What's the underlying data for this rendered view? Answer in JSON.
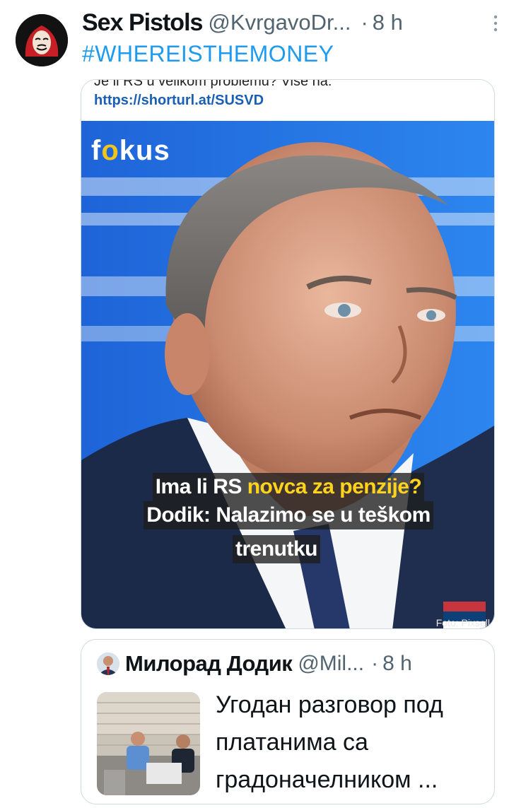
{
  "tweet": {
    "display_name": "Sex Pistols",
    "handle": "@KvrgavoDr...",
    "dot": "·",
    "time": "8 h",
    "hashtag": "#WHEREISTHEMONEY",
    "avatar_icon": "money-heist-mask-icon",
    "more_icon": "more-vertical-icon"
  },
  "media": {
    "cut_text": "Je li RS u velikom problemu? Više na:",
    "link": "https://shorturl.at/SUSVD",
    "logo_prefix": "f",
    "logo_o": "o",
    "logo_suffix": "kus",
    "headline_line1_a": "Ima li RS ",
    "headline_line1_b": "novca za penzije?",
    "headline_line2": "Dodik: Nalazimo se u teškom",
    "headline_line3": "trenutku",
    "photo_credit": "Foto: Pixsell",
    "accent_blue": "#1f6fe0",
    "accent_yellow": "#ffd21c"
  },
  "quote": {
    "display_name": "Милорад Додик",
    "handle": "@Mil...",
    "dot": "·",
    "time": "8 h",
    "text": "Угодан разговор под платанима са градоначелником ..."
  }
}
